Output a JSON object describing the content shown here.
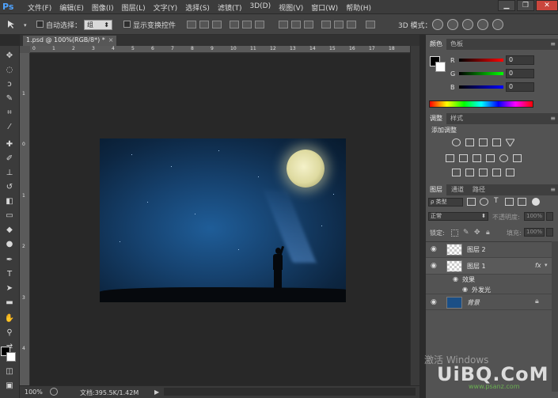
{
  "app": {
    "logo": "Ps"
  },
  "menu": [
    "文件(F)",
    "编辑(E)",
    "图像(I)",
    "图层(L)",
    "文字(Y)",
    "选择(S)",
    "滤镜(T)",
    "3D(D)",
    "视图(V)",
    "窗口(W)",
    "帮助(H)"
  ],
  "window_buttons": {
    "minimize": "▁",
    "restore": "❐",
    "close": "✕"
  },
  "options": {
    "auto_select_label": "自动选择：",
    "auto_select_value": "组",
    "show_transform_label": "显示变换控件",
    "mode_3d_label": "3D 模式："
  },
  "document": {
    "tab_title": "1.psd @ 100%(RGB/8*) *",
    "tab_close": "×"
  },
  "rulers": {
    "h": [
      "0",
      "1",
      "2",
      "3",
      "4",
      "5",
      "6",
      "7",
      "8",
      "9",
      "10",
      "11",
      "12",
      "13",
      "14",
      "15",
      "16",
      "17",
      "18"
    ],
    "v": [
      "1",
      "0",
      "1",
      "2",
      "3",
      "4"
    ]
  },
  "status": {
    "zoom": "100%",
    "doc_info": "文档:395.5K/1.42M"
  },
  "color_panel": {
    "tabs": [
      "颜色",
      "色板"
    ],
    "channels": [
      {
        "label": "R",
        "value": "0"
      },
      {
        "label": "G",
        "value": "0"
      },
      {
        "label": "B",
        "value": "0"
      }
    ]
  },
  "adjust_panel": {
    "tabs": [
      "调整",
      "样式"
    ],
    "title": "添加调整"
  },
  "layers_panel": {
    "tabs": [
      "图层",
      "通道",
      "路径"
    ],
    "filter_value": "ρ 类型",
    "blend_mode": "正常",
    "opacity_label": "不透明度:",
    "opacity_value": "100%",
    "lock_label": "锁定:",
    "fill_label": "填充:",
    "fill_value": "100%",
    "layers": [
      {
        "name": "图层 2"
      },
      {
        "name": "图层 1",
        "fx": "fx"
      },
      {
        "name": "背景"
      }
    ],
    "effects_label": "效果",
    "effect_item": "外发光"
  },
  "watermark": {
    "activate": "激活 Windows",
    "logo": "UiBQ.CoM",
    "url": "www.psanz.com"
  }
}
